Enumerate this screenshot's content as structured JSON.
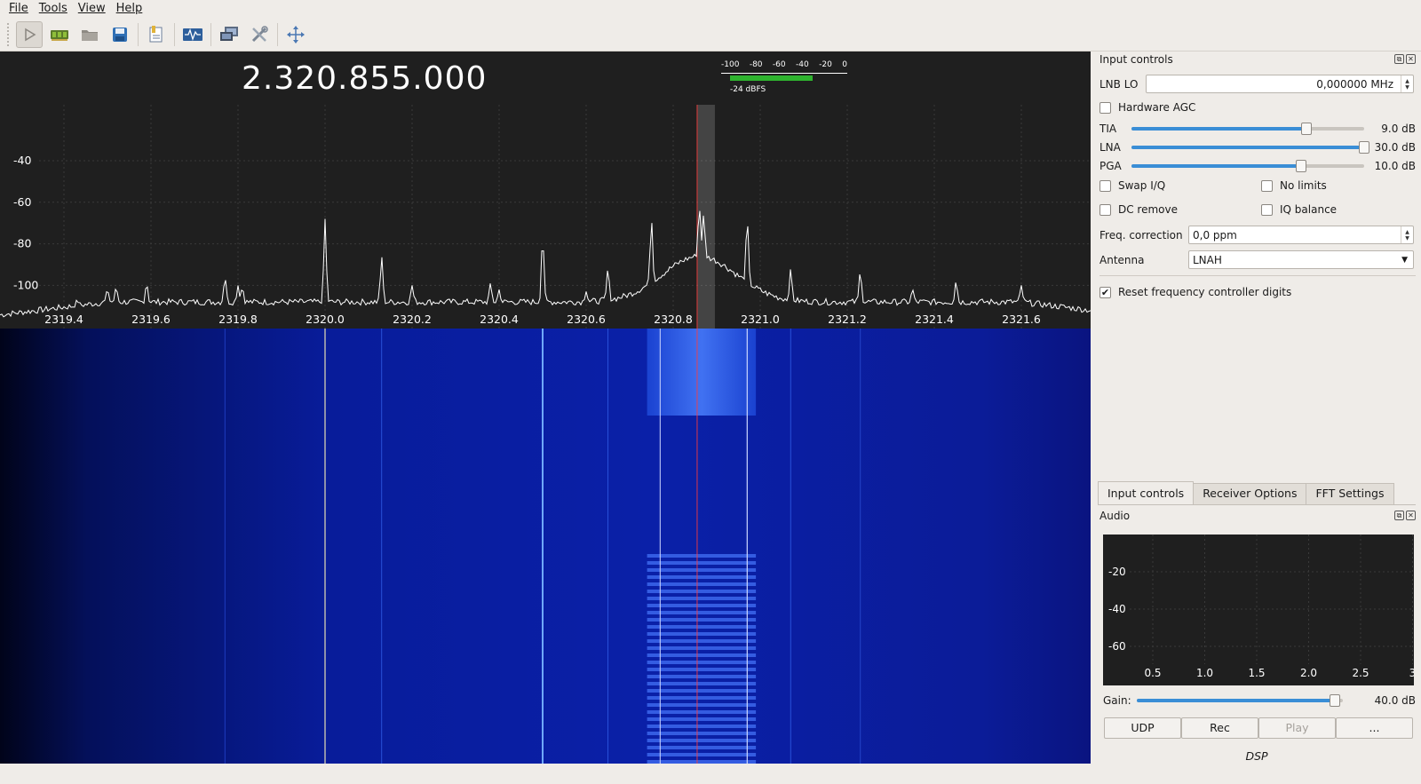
{
  "menu": {
    "file": "File",
    "tools": "Tools",
    "view": "View",
    "help": "Help"
  },
  "toolbar": {
    "buttons": [
      "play-icon",
      "hardware-board-icon",
      "open-folder-icon",
      "save-icon",
      "bookmark-icon",
      "waveform-icon",
      "remote-control-icon",
      "tools-icon",
      "fit-arrows-icon"
    ]
  },
  "frequency": {
    "display": "2.320.855.000"
  },
  "dbfs_meter": {
    "scale": [
      "-100",
      "-80",
      "-60",
      "-40",
      "-20",
      "0"
    ],
    "level_dbfs": -24,
    "label": "-24 dBFS",
    "bar_color": "#2fb32f"
  },
  "spectrum": {
    "x_ticks": [
      "2319.4",
      "2319.6",
      "2319.8",
      "2320.0",
      "2320.2",
      "2320.4",
      "2320.6",
      "2320.8",
      "2321.0",
      "2321.2",
      "2321.4",
      "2321.6"
    ],
    "y_ticks": [
      "-40",
      "-60",
      "-80",
      "-100"
    ],
    "colors": {
      "background": "#1f1f1f",
      "trace": "#ffffff",
      "marker": "#ff3b3b",
      "waterfall": "#0a1a8a"
    }
  },
  "input_controls": {
    "title": "Input controls",
    "lnb_lo": {
      "label": "LNB LO",
      "value": "0,000000 MHz"
    },
    "hardware_agc": {
      "label": "Hardware AGC",
      "checked": false
    },
    "gains": [
      {
        "label": "TIA",
        "value": "9.0 dB",
        "fraction": 0.75
      },
      {
        "label": "LNA",
        "value": "30.0 dB",
        "fraction": 1.0
      },
      {
        "label": "PGA",
        "value": "10.0 dB",
        "fraction": 0.73
      }
    ],
    "swap_iq": {
      "label": "Swap I/Q",
      "checked": false
    },
    "no_limits": {
      "label": "No limits",
      "checked": false
    },
    "dc_remove": {
      "label": "DC remove",
      "checked": false
    },
    "iq_balance": {
      "label": "IQ balance",
      "checked": false
    },
    "freq_correction": {
      "label": "Freq. correction",
      "value": "0,0 ppm"
    },
    "antenna": {
      "label": "Antenna",
      "value": "LNAH"
    },
    "reset_digits": {
      "label": "Reset frequency controller digits",
      "checked": true
    }
  },
  "tabs": [
    "Input controls",
    "Receiver Options",
    "FFT Settings"
  ],
  "audio": {
    "title": "Audio",
    "y_ticks": [
      "-20",
      "-40",
      "-60"
    ],
    "x_ticks": [
      "0.5",
      "1.0",
      "1.5",
      "2.0",
      "2.5",
      "3"
    ],
    "gain": {
      "label": "Gain:",
      "value": "40.0 dB",
      "fraction": 0.96
    },
    "buttons": {
      "udp": "UDP",
      "rec": "Rec",
      "play": "Play",
      "more": "..."
    },
    "dsp_label": "DSP"
  }
}
